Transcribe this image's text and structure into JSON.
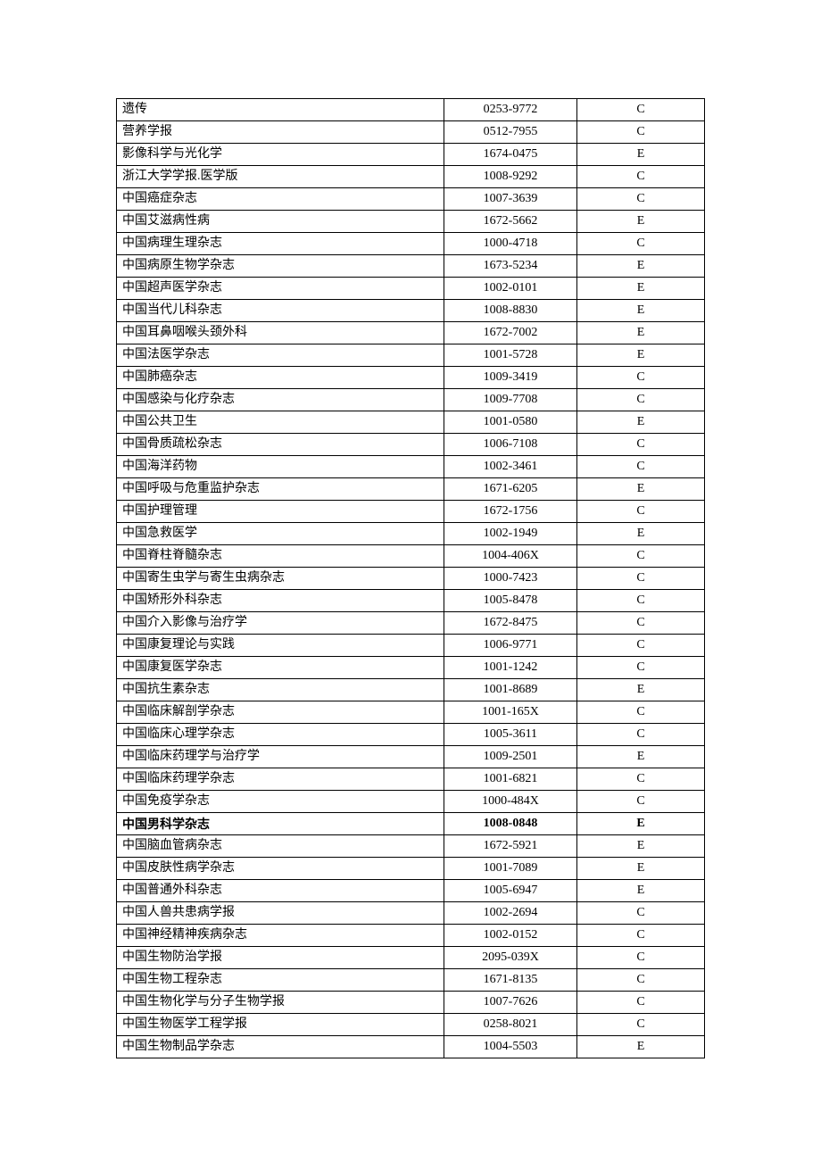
{
  "rows": [
    {
      "name": "遗传",
      "issn": "0253-9772",
      "grade": "C",
      "bold": false
    },
    {
      "name": "营养学报",
      "issn": "0512-7955",
      "grade": "C",
      "bold": false
    },
    {
      "name": "影像科学与光化学",
      "issn": "1674-0475",
      "grade": "E",
      "bold": false
    },
    {
      "name": "浙江大学学报.医学版",
      "issn": "1008-9292",
      "grade": "C",
      "bold": false
    },
    {
      "name": "中国癌症杂志",
      "issn": "1007-3639",
      "grade": "C",
      "bold": false
    },
    {
      "name": "中国艾滋病性病",
      "issn": "1672-5662",
      "grade": "E",
      "bold": false
    },
    {
      "name": "中国病理生理杂志",
      "issn": "1000-4718",
      "grade": "C",
      "bold": false
    },
    {
      "name": "中国病原生物学杂志",
      "issn": "1673-5234",
      "grade": "E",
      "bold": false
    },
    {
      "name": "中国超声医学杂志",
      "issn": "1002-0101",
      "grade": "E",
      "bold": false
    },
    {
      "name": "中国当代儿科杂志",
      "issn": "1008-8830",
      "grade": "E",
      "bold": false
    },
    {
      "name": "中国耳鼻咽喉头颈外科",
      "issn": "1672-7002",
      "grade": "E",
      "bold": false
    },
    {
      "name": "中国法医学杂志",
      "issn": "1001-5728",
      "grade": "E",
      "bold": false
    },
    {
      "name": "中国肺癌杂志",
      "issn": "1009-3419",
      "grade": "C",
      "bold": false
    },
    {
      "name": "中国感染与化疗杂志",
      "issn": "1009-7708",
      "grade": "C",
      "bold": false
    },
    {
      "name": "中国公共卫生",
      "issn": "1001-0580",
      "grade": "E",
      "bold": false
    },
    {
      "name": "中国骨质疏松杂志",
      "issn": "1006-7108",
      "grade": "C",
      "bold": false
    },
    {
      "name": "中国海洋药物",
      "issn": "1002-3461",
      "grade": "C",
      "bold": false
    },
    {
      "name": "中国呼吸与危重监护杂志",
      "issn": "1671-6205",
      "grade": "E",
      "bold": false
    },
    {
      "name": "中国护理管理",
      "issn": "1672-1756",
      "grade": "C",
      "bold": false
    },
    {
      "name": "中国急救医学",
      "issn": "1002-1949",
      "grade": "E",
      "bold": false
    },
    {
      "name": "中国脊柱脊髓杂志",
      "issn": "1004-406X",
      "grade": "C",
      "bold": false
    },
    {
      "name": "中国寄生虫学与寄生虫病杂志",
      "issn": "1000-7423",
      "grade": "C",
      "bold": false
    },
    {
      "name": "中国矫形外科杂志",
      "issn": "1005-8478",
      "grade": "C",
      "bold": false
    },
    {
      "name": "中国介入影像与治疗学",
      "issn": "1672-8475",
      "grade": "C",
      "bold": false
    },
    {
      "name": "中国康复理论与实践",
      "issn": "1006-9771",
      "grade": "C",
      "bold": false
    },
    {
      "name": "中国康复医学杂志",
      "issn": "1001-1242",
      "grade": "C",
      "bold": false
    },
    {
      "name": "中国抗生素杂志",
      "issn": "1001-8689",
      "grade": "E",
      "bold": false
    },
    {
      "name": "中国临床解剖学杂志",
      "issn": "1001-165X",
      "grade": "C",
      "bold": false
    },
    {
      "name": "中国临床心理学杂志",
      "issn": "1005-3611",
      "grade": "C",
      "bold": false
    },
    {
      "name": "中国临床药理学与治疗学",
      "issn": "1009-2501",
      "grade": "E",
      "bold": false
    },
    {
      "name": "中国临床药理学杂志",
      "issn": "1001-6821",
      "grade": "C",
      "bold": false
    },
    {
      "name": "中国免疫学杂志",
      "issn": "1000-484X",
      "grade": "C",
      "bold": false
    },
    {
      "name": "中国男科学杂志",
      "issn": "1008-0848",
      "grade": "E",
      "bold": true
    },
    {
      "name": "中国脑血管病杂志",
      "issn": "1672-5921",
      "grade": "E",
      "bold": false
    },
    {
      "name": "中国皮肤性病学杂志",
      "issn": "1001-7089",
      "grade": "E",
      "bold": false
    },
    {
      "name": "中国普通外科杂志",
      "issn": "1005-6947",
      "grade": "E",
      "bold": false
    },
    {
      "name": "中国人兽共患病学报",
      "issn": "1002-2694",
      "grade": "C",
      "bold": false
    },
    {
      "name": "中国神经精神疾病杂志",
      "issn": "1002-0152",
      "grade": "C",
      "bold": false
    },
    {
      "name": "中国生物防治学报",
      "issn": "2095-039X",
      "grade": "C",
      "bold": false
    },
    {
      "name": "中国生物工程杂志",
      "issn": "1671-8135",
      "grade": "C",
      "bold": false
    },
    {
      "name": "中国生物化学与分子生物学报",
      "issn": "1007-7626",
      "grade": "C",
      "bold": false
    },
    {
      "name": "中国生物医学工程学报",
      "issn": "0258-8021",
      "grade": "C",
      "bold": false
    },
    {
      "name": "中国生物制品学杂志",
      "issn": "1004-5503",
      "grade": "E",
      "bold": false
    }
  ]
}
